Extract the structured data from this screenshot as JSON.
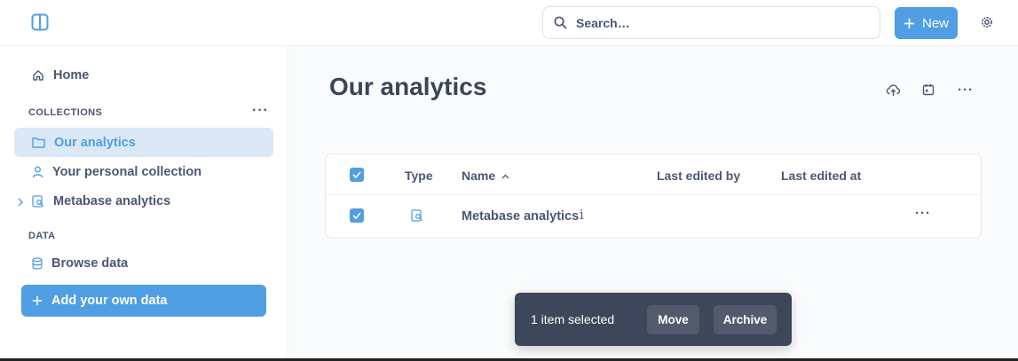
{
  "topbar": {
    "search_placeholder": "Search…",
    "new_label": "New"
  },
  "sidebar": {
    "home_label": "Home",
    "collections_label": "COLLECTIONS",
    "items": [
      {
        "label": "Our analytics",
        "icon": "folder-icon",
        "active": true
      },
      {
        "label": "Your personal collection",
        "icon": "person-icon"
      },
      {
        "label": "Metabase analytics",
        "icon": "audit-icon"
      }
    ],
    "data_label": "DATA",
    "browse_label": "Browse data",
    "add_data_label": "Add your own data"
  },
  "main": {
    "title": "Our analytics",
    "table": {
      "headers": {
        "type": "Type",
        "name": "Name",
        "last_edited_by": "Last edited by",
        "last_edited_at": "Last edited at"
      },
      "rows": [
        {
          "name": "Metabase analytics",
          "type_icon": "audit-icon",
          "info": "i",
          "selected": true
        }
      ]
    }
  },
  "selection_bar": {
    "count_text": "1 item selected",
    "move_label": "Move",
    "archive_label": "Archive"
  },
  "colors": {
    "brand": "#509ee3",
    "text": "#4c5773",
    "active_bg": "#dbe9f7",
    "bar_bg": "#3e4659"
  }
}
